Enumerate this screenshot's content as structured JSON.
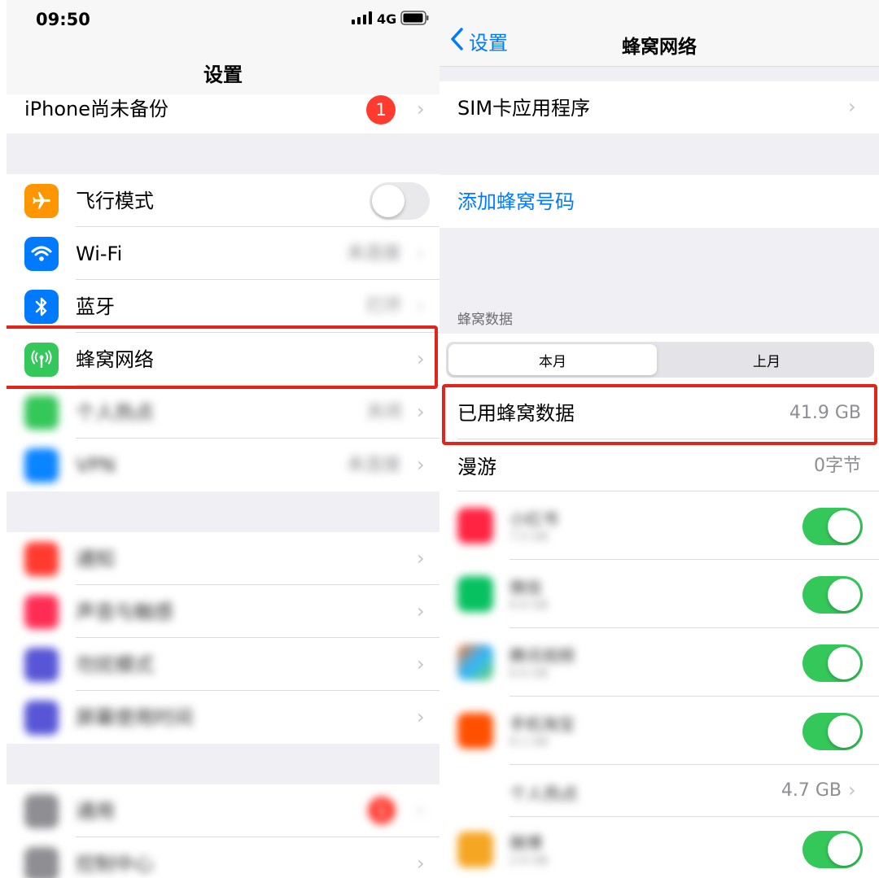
{
  "left": {
    "status_bar": {
      "time": "09:50",
      "network": "4G"
    },
    "nav_title": "设置",
    "backup_row": {
      "label": "iPhone尚未备份",
      "badge": "1"
    },
    "group1": [
      {
        "label": "飞行模式",
        "icon": "airplane-icon",
        "color": "#ff9500",
        "control": "toggle-off"
      },
      {
        "label": "Wi-Fi",
        "icon": "wifi-icon",
        "color": "#007aff",
        "value": "未连接"
      },
      {
        "label": "蓝牙",
        "icon": "bluetooth-icon",
        "color": "#007aff",
        "value": "打开"
      },
      {
        "label": "蜂窝网络",
        "icon": "cellular-icon",
        "color": "#34c759"
      },
      {
        "label": "个人热点",
        "icon": "hotspot-icon",
        "color": "#34c759",
        "value": "关闭"
      },
      {
        "label": "VPN",
        "icon": "vpn-icon",
        "color": "#0a84ff",
        "value": "未连接"
      }
    ],
    "group2": [
      {
        "label": "通知",
        "icon": "notifications-icon",
        "color": "#ff3b30"
      },
      {
        "label": "声音与触感",
        "icon": "sound-icon",
        "color": "#ff2d55"
      },
      {
        "label": "勿扰模式",
        "icon": "do-not-disturb-icon",
        "color": "#5856d6"
      },
      {
        "label": "屏幕使用时间",
        "icon": "screen-time-icon",
        "color": "#5856d6"
      }
    ],
    "group3": [
      {
        "label": "通用",
        "icon": "general-icon",
        "color": "#8e8e93",
        "badge": "1"
      },
      {
        "label": "控制中心",
        "icon": "control-center-icon",
        "color": "#8e8e93"
      }
    ]
  },
  "right": {
    "back_label": "设置",
    "nav_title": "蜂窝网络",
    "sim_row": "SIM卡应用程序",
    "add_number": "添加蜂窝号码",
    "section_header": "蜂窝数据",
    "segments": [
      "本月",
      "上月"
    ],
    "used_data": {
      "label": "已用蜂窝数据",
      "value": "41.9 GB"
    },
    "roaming": {
      "label": "漫游",
      "value": "0字节"
    },
    "apps": [
      {
        "name": "小红书",
        "usage": "7.5 GB",
        "icon": "xiaohongshu-icon",
        "color": "#ff2442",
        "enabled": true
      },
      {
        "name": "微信",
        "usage": "6.6 GB",
        "icon": "wechat-icon",
        "color": "#07c160",
        "enabled": true
      },
      {
        "name": "腾讯视频",
        "usage": "6.6 GB",
        "icon": "tencent-video-icon",
        "color": "#ff7a2f",
        "enabled": true
      },
      {
        "name": "手机淘宝",
        "usage": "6.1 GB",
        "icon": "taobao-icon",
        "color": "#ff5000",
        "enabled": true
      }
    ],
    "hotspot_row": {
      "label": "个人热点",
      "value": "4.7 GB"
    },
    "last_app": {
      "name": "微博",
      "usage": "2.6 GB",
      "icon": "weibo-icon",
      "color": "#f5a623",
      "enabled": true
    }
  },
  "colors": {
    "highlight": "#e0261c",
    "ios_blue": "#007aff",
    "toggle_on": "#34c759",
    "badge_red": "#ff3b30"
  }
}
